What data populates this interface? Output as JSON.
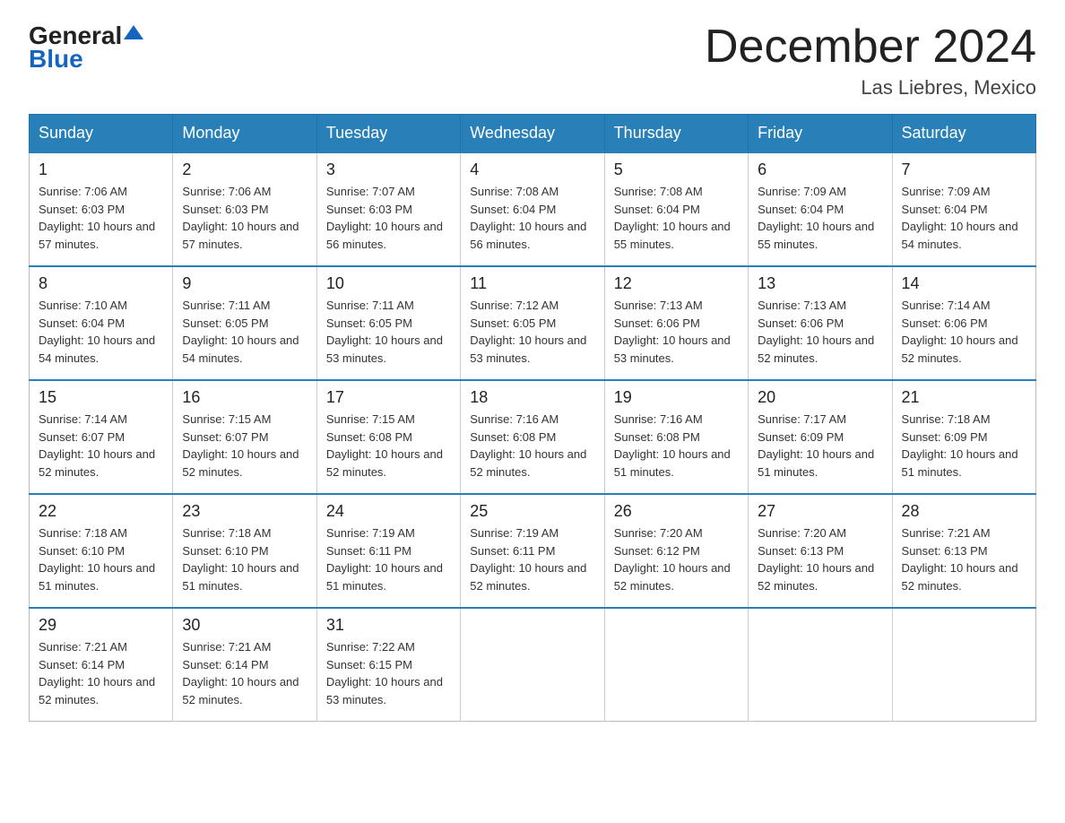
{
  "header": {
    "logo_general": "General",
    "logo_blue": "Blue",
    "month_title": "December 2024",
    "location": "Las Liebres, Mexico"
  },
  "calendar": {
    "days_of_week": [
      "Sunday",
      "Monday",
      "Tuesday",
      "Wednesday",
      "Thursday",
      "Friday",
      "Saturday"
    ],
    "weeks": [
      [
        {
          "day": "1",
          "sunrise": "7:06 AM",
          "sunset": "6:03 PM",
          "daylight": "10 hours and 57 minutes."
        },
        {
          "day": "2",
          "sunrise": "7:06 AM",
          "sunset": "6:03 PM",
          "daylight": "10 hours and 57 minutes."
        },
        {
          "day": "3",
          "sunrise": "7:07 AM",
          "sunset": "6:03 PM",
          "daylight": "10 hours and 56 minutes."
        },
        {
          "day": "4",
          "sunrise": "7:08 AM",
          "sunset": "6:04 PM",
          "daylight": "10 hours and 56 minutes."
        },
        {
          "day": "5",
          "sunrise": "7:08 AM",
          "sunset": "6:04 PM",
          "daylight": "10 hours and 55 minutes."
        },
        {
          "day": "6",
          "sunrise": "7:09 AM",
          "sunset": "6:04 PM",
          "daylight": "10 hours and 55 minutes."
        },
        {
          "day": "7",
          "sunrise": "7:09 AM",
          "sunset": "6:04 PM",
          "daylight": "10 hours and 54 minutes."
        }
      ],
      [
        {
          "day": "8",
          "sunrise": "7:10 AM",
          "sunset": "6:04 PM",
          "daylight": "10 hours and 54 minutes."
        },
        {
          "day": "9",
          "sunrise": "7:11 AM",
          "sunset": "6:05 PM",
          "daylight": "10 hours and 54 minutes."
        },
        {
          "day": "10",
          "sunrise": "7:11 AM",
          "sunset": "6:05 PM",
          "daylight": "10 hours and 53 minutes."
        },
        {
          "day": "11",
          "sunrise": "7:12 AM",
          "sunset": "6:05 PM",
          "daylight": "10 hours and 53 minutes."
        },
        {
          "day": "12",
          "sunrise": "7:13 AM",
          "sunset": "6:06 PM",
          "daylight": "10 hours and 53 minutes."
        },
        {
          "day": "13",
          "sunrise": "7:13 AM",
          "sunset": "6:06 PM",
          "daylight": "10 hours and 52 minutes."
        },
        {
          "day": "14",
          "sunrise": "7:14 AM",
          "sunset": "6:06 PM",
          "daylight": "10 hours and 52 minutes."
        }
      ],
      [
        {
          "day": "15",
          "sunrise": "7:14 AM",
          "sunset": "6:07 PM",
          "daylight": "10 hours and 52 minutes."
        },
        {
          "day": "16",
          "sunrise": "7:15 AM",
          "sunset": "6:07 PM",
          "daylight": "10 hours and 52 minutes."
        },
        {
          "day": "17",
          "sunrise": "7:15 AM",
          "sunset": "6:08 PM",
          "daylight": "10 hours and 52 minutes."
        },
        {
          "day": "18",
          "sunrise": "7:16 AM",
          "sunset": "6:08 PM",
          "daylight": "10 hours and 52 minutes."
        },
        {
          "day": "19",
          "sunrise": "7:16 AM",
          "sunset": "6:08 PM",
          "daylight": "10 hours and 51 minutes."
        },
        {
          "day": "20",
          "sunrise": "7:17 AM",
          "sunset": "6:09 PM",
          "daylight": "10 hours and 51 minutes."
        },
        {
          "day": "21",
          "sunrise": "7:18 AM",
          "sunset": "6:09 PM",
          "daylight": "10 hours and 51 minutes."
        }
      ],
      [
        {
          "day": "22",
          "sunrise": "7:18 AM",
          "sunset": "6:10 PM",
          "daylight": "10 hours and 51 minutes."
        },
        {
          "day": "23",
          "sunrise": "7:18 AM",
          "sunset": "6:10 PM",
          "daylight": "10 hours and 51 minutes."
        },
        {
          "day": "24",
          "sunrise": "7:19 AM",
          "sunset": "6:11 PM",
          "daylight": "10 hours and 51 minutes."
        },
        {
          "day": "25",
          "sunrise": "7:19 AM",
          "sunset": "6:11 PM",
          "daylight": "10 hours and 52 minutes."
        },
        {
          "day": "26",
          "sunrise": "7:20 AM",
          "sunset": "6:12 PM",
          "daylight": "10 hours and 52 minutes."
        },
        {
          "day": "27",
          "sunrise": "7:20 AM",
          "sunset": "6:13 PM",
          "daylight": "10 hours and 52 minutes."
        },
        {
          "day": "28",
          "sunrise": "7:21 AM",
          "sunset": "6:13 PM",
          "daylight": "10 hours and 52 minutes."
        }
      ],
      [
        {
          "day": "29",
          "sunrise": "7:21 AM",
          "sunset": "6:14 PM",
          "daylight": "10 hours and 52 minutes."
        },
        {
          "day": "30",
          "sunrise": "7:21 AM",
          "sunset": "6:14 PM",
          "daylight": "10 hours and 52 minutes."
        },
        {
          "day": "31",
          "sunrise": "7:22 AM",
          "sunset": "6:15 PM",
          "daylight": "10 hours and 53 minutes."
        },
        null,
        null,
        null,
        null
      ]
    ]
  }
}
